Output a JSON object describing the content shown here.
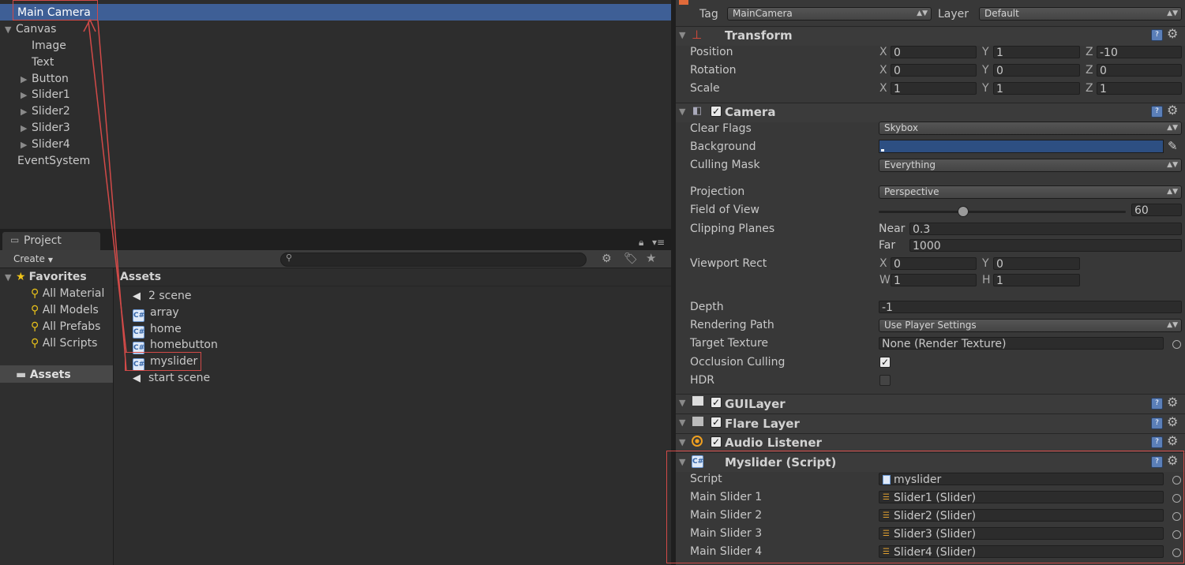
{
  "hierarchy": {
    "items": [
      {
        "label": "Main Camera"
      },
      {
        "label": "Canvas"
      },
      {
        "label": "Image"
      },
      {
        "label": "Text"
      },
      {
        "label": "Button"
      },
      {
        "label": "Slider1"
      },
      {
        "label": "Slider2"
      },
      {
        "label": "Slider3"
      },
      {
        "label": "Slider4"
      },
      {
        "label": "EventSystem"
      }
    ]
  },
  "project": {
    "tab_label": "Project",
    "create_label": "Create",
    "favorites_label": "Favorites",
    "favorites": [
      "All Material",
      "All Models",
      "All Prefabs",
      "All Scripts"
    ],
    "assets_root": "Assets",
    "assets_header": "Assets",
    "assets": [
      {
        "label": "2 scene",
        "icon": "unity-scene-icon"
      },
      {
        "label": "array",
        "icon": "cs-script-icon"
      },
      {
        "label": "home",
        "icon": "cs-script-icon"
      },
      {
        "label": "homebutton",
        "icon": "cs-script-icon"
      },
      {
        "label": "myslider",
        "icon": "cs-script-icon"
      },
      {
        "label": "start scene",
        "icon": "unity-scene-icon"
      }
    ]
  },
  "inspector": {
    "tag_label": "Tag",
    "tag_value": "MainCamera",
    "layer_label": "Layer",
    "layer_value": "Default",
    "transform": {
      "title": "Transform",
      "position_label": "Position",
      "position": {
        "x": "0",
        "y": "1",
        "z": "-10"
      },
      "rotation_label": "Rotation",
      "rotation": {
        "x": "0",
        "y": "0",
        "z": "0"
      },
      "scale_label": "Scale",
      "scale": {
        "x": "1",
        "y": "1",
        "z": "1"
      }
    },
    "camera": {
      "title": "Camera",
      "clear_flags_label": "Clear Flags",
      "clear_flags": "Skybox",
      "background_label": "Background",
      "background_color": "#2d4f82",
      "culling_mask_label": "Culling Mask",
      "culling_mask": "Everything",
      "projection_label": "Projection",
      "projection": "Perspective",
      "fov_label": "Field of View",
      "fov": "60",
      "fov_fraction": 0.34,
      "clipping_label": "Clipping Planes",
      "near_label": "Near",
      "near": "0.3",
      "far_label": "Far",
      "far": "1000",
      "viewport_label": "Viewport Rect",
      "vx_label": "X",
      "vx": "0",
      "vy_label": "Y",
      "vy": "0",
      "vw_label": "W",
      "vw": "1",
      "vh_label": "H",
      "vh": "1",
      "depth_label": "Depth",
      "depth": "-1",
      "rendering_label": "Rendering Path",
      "rendering": "Use Player Settings",
      "target_label": "Target Texture",
      "target": "None (Render Texture)",
      "occlusion_label": "Occlusion Culling",
      "hdr_label": "HDR"
    },
    "guilayer": {
      "title": "GUILayer"
    },
    "flare": {
      "title": "Flare Layer"
    },
    "audio": {
      "title": "Audio Listener"
    },
    "myslider": {
      "title": "Myslider (Script)",
      "script_label": "Script",
      "script_value": "myslider",
      "fields": [
        {
          "label": "Main Slider 1",
          "value": "Slider1 (Slider)"
        },
        {
          "label": "Main Slider 2",
          "value": "Slider2 (Slider)"
        },
        {
          "label": "Main Slider 3",
          "value": "Slider3 (Slider)"
        },
        {
          "label": "Main Slider 4",
          "value": "Slider4 (Slider)"
        }
      ]
    }
  },
  "axis_labels": {
    "x": "X",
    "y": "Y",
    "z": "Z"
  }
}
